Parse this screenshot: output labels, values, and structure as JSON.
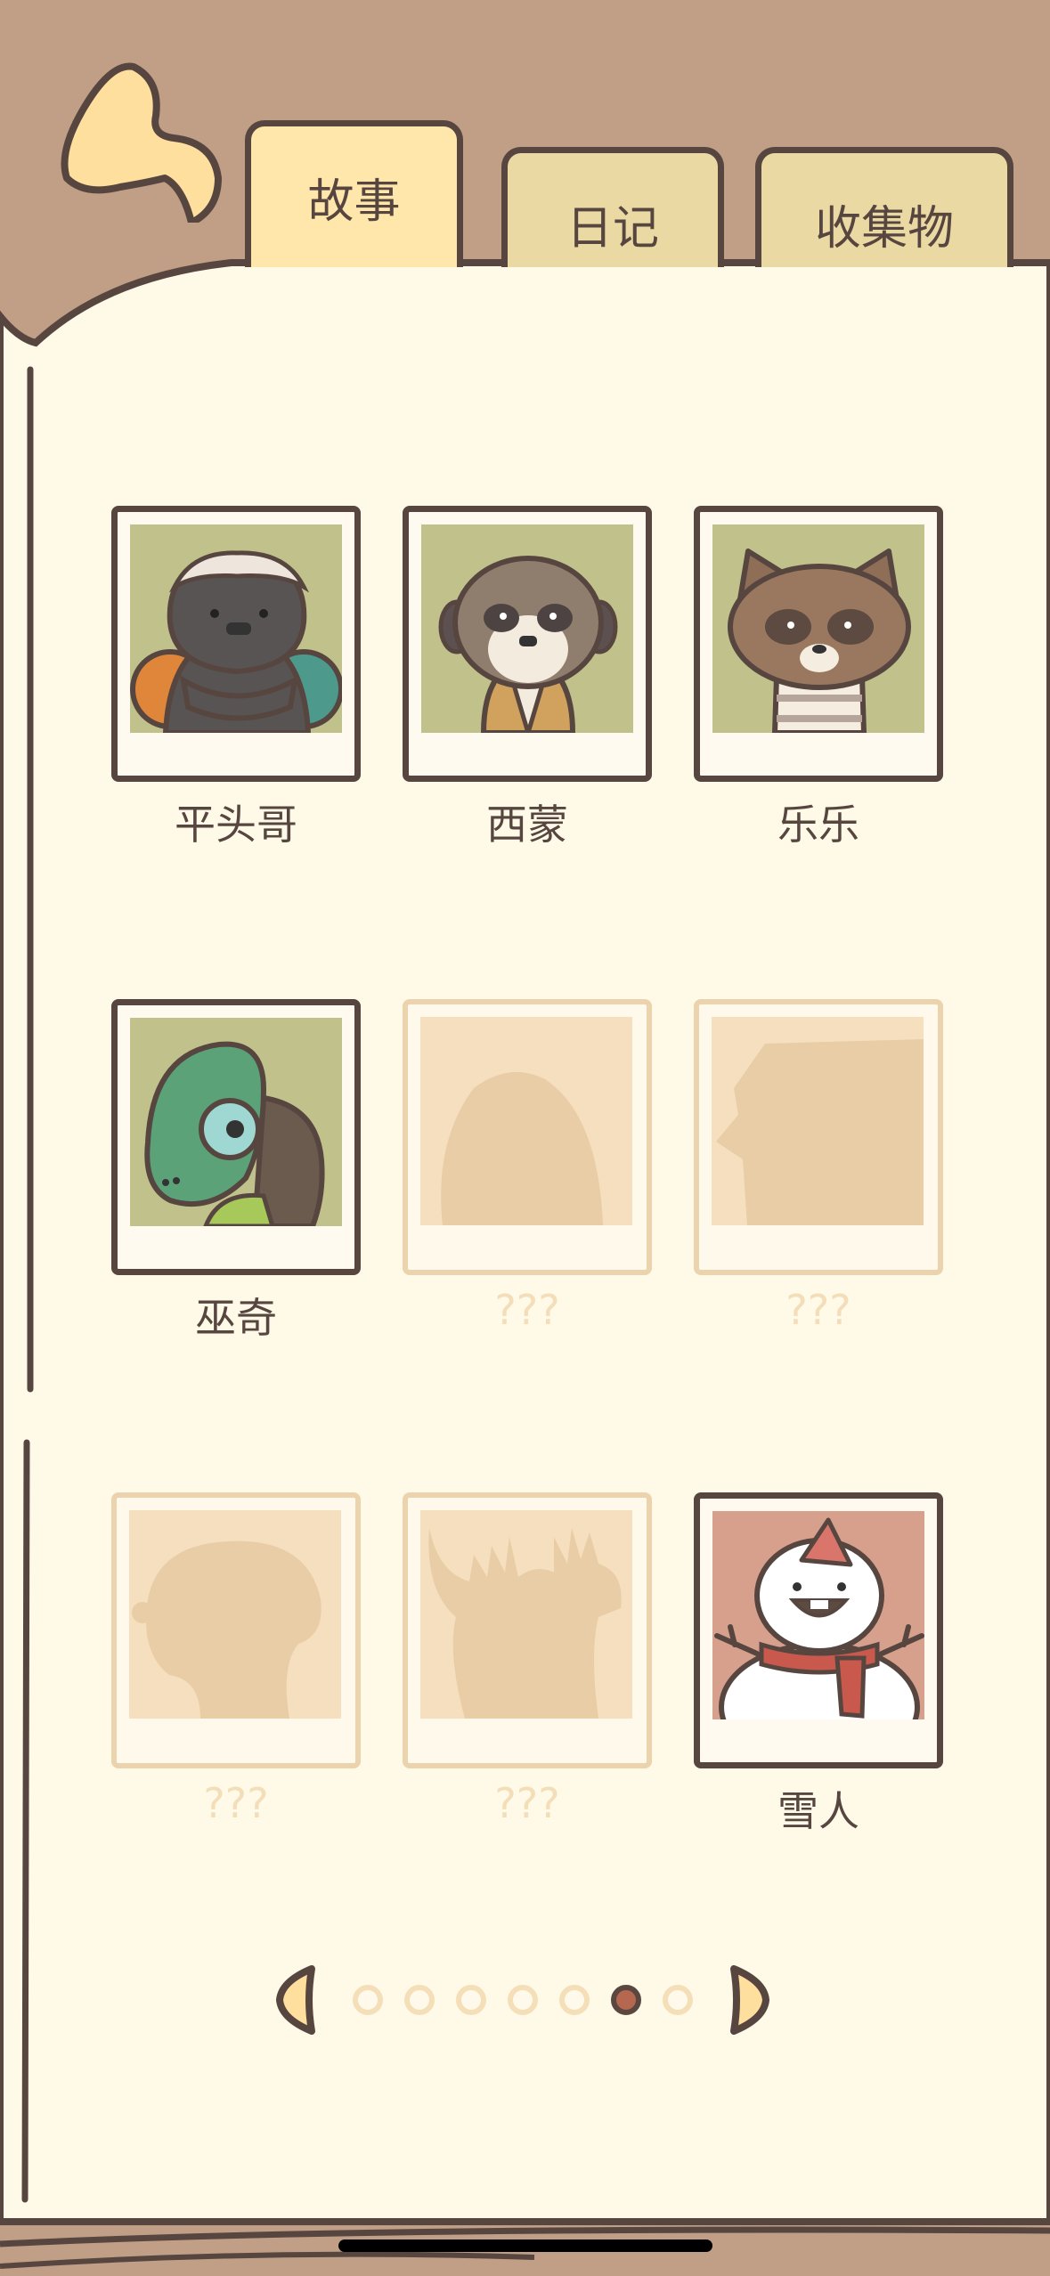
{
  "nav": {
    "back_icon": "curved-back-arrow-icon",
    "tabs": [
      {
        "label": "故事",
        "active": true
      },
      {
        "label": "日记",
        "active": false
      },
      {
        "label": "收集物",
        "active": false
      }
    ]
  },
  "characters": [
    {
      "name": "平头哥",
      "unlocked": true,
      "portrait": "honey-badger-portrait"
    },
    {
      "name": "西蒙",
      "unlocked": true,
      "portrait": "meerkat-portrait"
    },
    {
      "name": "乐乐",
      "unlocked": true,
      "portrait": "raccoon-portrait"
    },
    {
      "name": "巫奇",
      "unlocked": true,
      "portrait": "chameleon-portrait"
    },
    {
      "name": "???",
      "unlocked": false,
      "portrait": "egg-silhouette"
    },
    {
      "name": "???",
      "unlocked": false,
      "portrait": "bird-silhouette"
    },
    {
      "name": "???",
      "unlocked": false,
      "portrait": "blob-silhouette"
    },
    {
      "name": "???",
      "unlocked": false,
      "portrait": "moose-silhouette"
    },
    {
      "name": "雪人",
      "unlocked": true,
      "portrait": "snowman-portrait"
    }
  ],
  "pagination": {
    "total_pages": 7,
    "current_page": 6,
    "prev_icon": "prev-page-arrow-icon",
    "next_icon": "next-page-arrow-icon"
  },
  "colors": {
    "background_brown": "#c19e86",
    "page_cream": "#fff9e8",
    "outline": "#574640",
    "active_tab": "#ffe6ab",
    "inactive_tab": "#ead9a2",
    "portrait_green": "#c1c18c",
    "portrait_pink": "#d7a08c",
    "locked_border": "#ebd3ad",
    "active_dot": "#b5684f"
  }
}
